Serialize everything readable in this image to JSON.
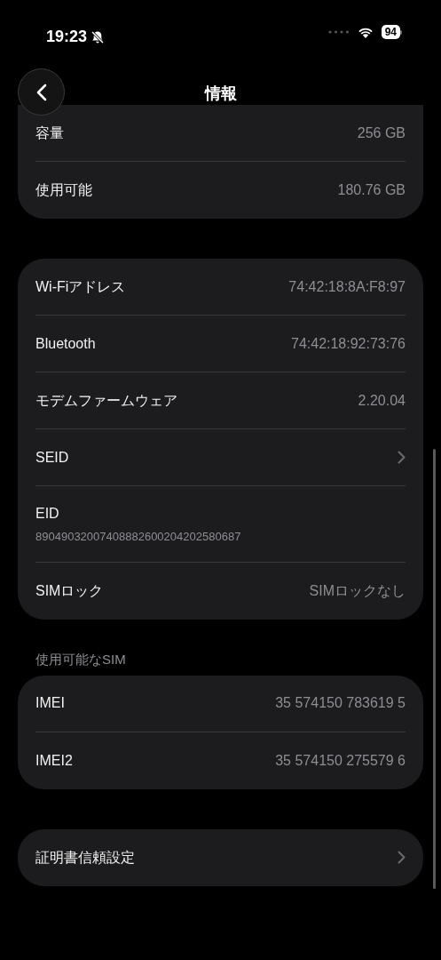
{
  "status_bar": {
    "time": "19:23",
    "silent": true,
    "battery": "94"
  },
  "header": {
    "title": "情報"
  },
  "sections": [
    {
      "rows": [
        {
          "kind": "value",
          "label": "容量",
          "value": "256 GB"
        },
        {
          "kind": "value",
          "label": "使用可能",
          "value": "180.76 GB"
        }
      ]
    },
    {
      "rows": [
        {
          "kind": "value",
          "label": "Wi-Fiアドレス",
          "value": "74:42:18:8A:F8:97"
        },
        {
          "kind": "value",
          "label": "Bluetooth",
          "value": "74:42:18:92:73:76"
        },
        {
          "kind": "value",
          "label": "モデムファームウェア",
          "value": "2.20.04"
        },
        {
          "kind": "chevron",
          "label": "SEID"
        },
        {
          "kind": "stacked",
          "label": "EID",
          "value": "89049032007408882600204202580687"
        },
        {
          "kind": "value",
          "label": "SIMロック",
          "value": "SIMロックなし"
        }
      ]
    },
    {
      "heading": "使用可能なSIM",
      "rows": [
        {
          "kind": "value",
          "label": "IMEI",
          "value": "35 574150 783619 5"
        },
        {
          "kind": "value",
          "label": "IMEI2",
          "value": "35 574150 275579 6"
        }
      ]
    },
    {
      "rows": [
        {
          "kind": "chevron",
          "label": "証明書信頼設定"
        }
      ]
    }
  ]
}
